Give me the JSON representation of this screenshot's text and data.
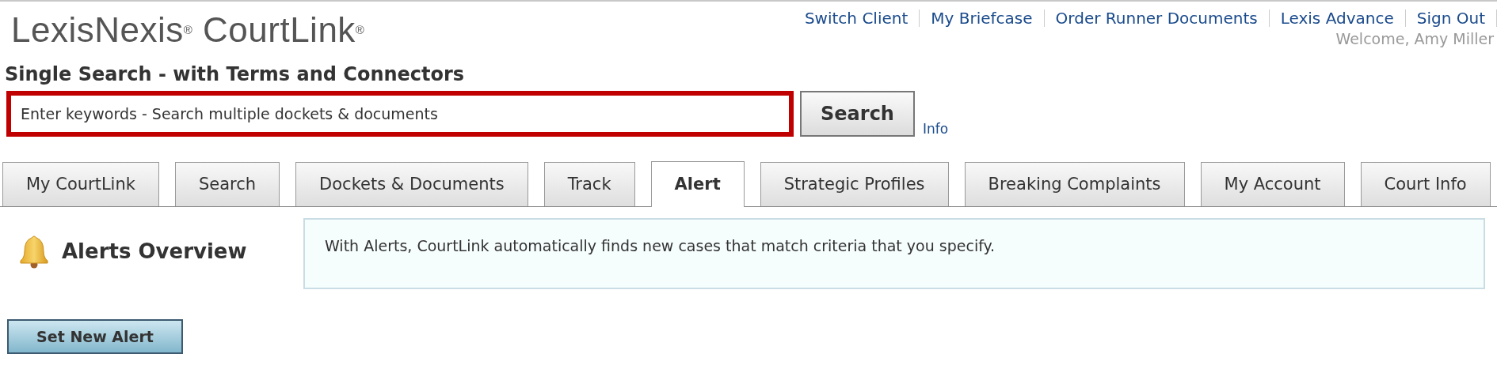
{
  "logo": "LexisNexis$^{®}$ CourtLink$^{®}$",
  "top_links": [
    "Switch Client",
    "My Briefcase",
    "Order Runner Documents",
    "Lexis Advance",
    "Sign Out"
  ],
  "welcome": "Welcome, Amy Miller",
  "search": {
    "heading": "Single Search - with Terms and Connectors",
    "placeholder": "Enter keywords - Search multiple dockets & documents",
    "button": "Search",
    "info_link": "Info"
  },
  "tabs": [
    {
      "label": "My CourtLink",
      "selected": false
    },
    {
      "label": "Search",
      "selected": false
    },
    {
      "label": "Dockets & Documents",
      "selected": false
    },
    {
      "label": "Track",
      "selected": false
    },
    {
      "label": "Alert",
      "selected": true
    },
    {
      "label": "Strategic Profiles",
      "selected": false
    },
    {
      "label": "Breaking Complaints",
      "selected": false
    },
    {
      "label": "My Account",
      "selected": false
    },
    {
      "label": "Court Info",
      "selected": false
    }
  ],
  "overview": {
    "title": "Alerts Overview",
    "description": "With Alerts, CourtLink automatically finds new cases that match criteria that you specify."
  },
  "action_button": "Set New Alert"
}
